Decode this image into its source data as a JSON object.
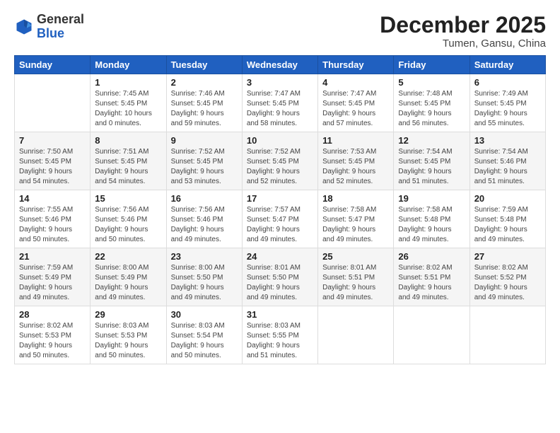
{
  "header": {
    "logo_general": "General",
    "logo_blue": "Blue",
    "month_title": "December 2025",
    "location": "Tumen, Gansu, China"
  },
  "weekdays": [
    "Sunday",
    "Monday",
    "Tuesday",
    "Wednesday",
    "Thursday",
    "Friday",
    "Saturday"
  ],
  "weeks": [
    [
      {
        "day": "",
        "info": ""
      },
      {
        "day": "1",
        "info": "Sunrise: 7:45 AM\nSunset: 5:45 PM\nDaylight: 10 hours\nand 0 minutes."
      },
      {
        "day": "2",
        "info": "Sunrise: 7:46 AM\nSunset: 5:45 PM\nDaylight: 9 hours\nand 59 minutes."
      },
      {
        "day": "3",
        "info": "Sunrise: 7:47 AM\nSunset: 5:45 PM\nDaylight: 9 hours\nand 58 minutes."
      },
      {
        "day": "4",
        "info": "Sunrise: 7:47 AM\nSunset: 5:45 PM\nDaylight: 9 hours\nand 57 minutes."
      },
      {
        "day": "5",
        "info": "Sunrise: 7:48 AM\nSunset: 5:45 PM\nDaylight: 9 hours\nand 56 minutes."
      },
      {
        "day": "6",
        "info": "Sunrise: 7:49 AM\nSunset: 5:45 PM\nDaylight: 9 hours\nand 55 minutes."
      }
    ],
    [
      {
        "day": "7",
        "info": "Sunrise: 7:50 AM\nSunset: 5:45 PM\nDaylight: 9 hours\nand 54 minutes."
      },
      {
        "day": "8",
        "info": "Sunrise: 7:51 AM\nSunset: 5:45 PM\nDaylight: 9 hours\nand 54 minutes."
      },
      {
        "day": "9",
        "info": "Sunrise: 7:52 AM\nSunset: 5:45 PM\nDaylight: 9 hours\nand 53 minutes."
      },
      {
        "day": "10",
        "info": "Sunrise: 7:52 AM\nSunset: 5:45 PM\nDaylight: 9 hours\nand 52 minutes."
      },
      {
        "day": "11",
        "info": "Sunrise: 7:53 AM\nSunset: 5:45 PM\nDaylight: 9 hours\nand 52 minutes."
      },
      {
        "day": "12",
        "info": "Sunrise: 7:54 AM\nSunset: 5:45 PM\nDaylight: 9 hours\nand 51 minutes."
      },
      {
        "day": "13",
        "info": "Sunrise: 7:54 AM\nSunset: 5:46 PM\nDaylight: 9 hours\nand 51 minutes."
      }
    ],
    [
      {
        "day": "14",
        "info": "Sunrise: 7:55 AM\nSunset: 5:46 PM\nDaylight: 9 hours\nand 50 minutes."
      },
      {
        "day": "15",
        "info": "Sunrise: 7:56 AM\nSunset: 5:46 PM\nDaylight: 9 hours\nand 50 minutes."
      },
      {
        "day": "16",
        "info": "Sunrise: 7:56 AM\nSunset: 5:46 PM\nDaylight: 9 hours\nand 49 minutes."
      },
      {
        "day": "17",
        "info": "Sunrise: 7:57 AM\nSunset: 5:47 PM\nDaylight: 9 hours\nand 49 minutes."
      },
      {
        "day": "18",
        "info": "Sunrise: 7:58 AM\nSunset: 5:47 PM\nDaylight: 9 hours\nand 49 minutes."
      },
      {
        "day": "19",
        "info": "Sunrise: 7:58 AM\nSunset: 5:48 PM\nDaylight: 9 hours\nand 49 minutes."
      },
      {
        "day": "20",
        "info": "Sunrise: 7:59 AM\nSunset: 5:48 PM\nDaylight: 9 hours\nand 49 minutes."
      }
    ],
    [
      {
        "day": "21",
        "info": "Sunrise: 7:59 AM\nSunset: 5:49 PM\nDaylight: 9 hours\nand 49 minutes."
      },
      {
        "day": "22",
        "info": "Sunrise: 8:00 AM\nSunset: 5:49 PM\nDaylight: 9 hours\nand 49 minutes."
      },
      {
        "day": "23",
        "info": "Sunrise: 8:00 AM\nSunset: 5:50 PM\nDaylight: 9 hours\nand 49 minutes."
      },
      {
        "day": "24",
        "info": "Sunrise: 8:01 AM\nSunset: 5:50 PM\nDaylight: 9 hours\nand 49 minutes."
      },
      {
        "day": "25",
        "info": "Sunrise: 8:01 AM\nSunset: 5:51 PM\nDaylight: 9 hours\nand 49 minutes."
      },
      {
        "day": "26",
        "info": "Sunrise: 8:02 AM\nSunset: 5:51 PM\nDaylight: 9 hours\nand 49 minutes."
      },
      {
        "day": "27",
        "info": "Sunrise: 8:02 AM\nSunset: 5:52 PM\nDaylight: 9 hours\nand 49 minutes."
      }
    ],
    [
      {
        "day": "28",
        "info": "Sunrise: 8:02 AM\nSunset: 5:53 PM\nDaylight: 9 hours\nand 50 minutes."
      },
      {
        "day": "29",
        "info": "Sunrise: 8:03 AM\nSunset: 5:53 PM\nDaylight: 9 hours\nand 50 minutes."
      },
      {
        "day": "30",
        "info": "Sunrise: 8:03 AM\nSunset: 5:54 PM\nDaylight: 9 hours\nand 50 minutes."
      },
      {
        "day": "31",
        "info": "Sunrise: 8:03 AM\nSunset: 5:55 PM\nDaylight: 9 hours\nand 51 minutes."
      },
      {
        "day": "",
        "info": ""
      },
      {
        "day": "",
        "info": ""
      },
      {
        "day": "",
        "info": ""
      }
    ]
  ]
}
